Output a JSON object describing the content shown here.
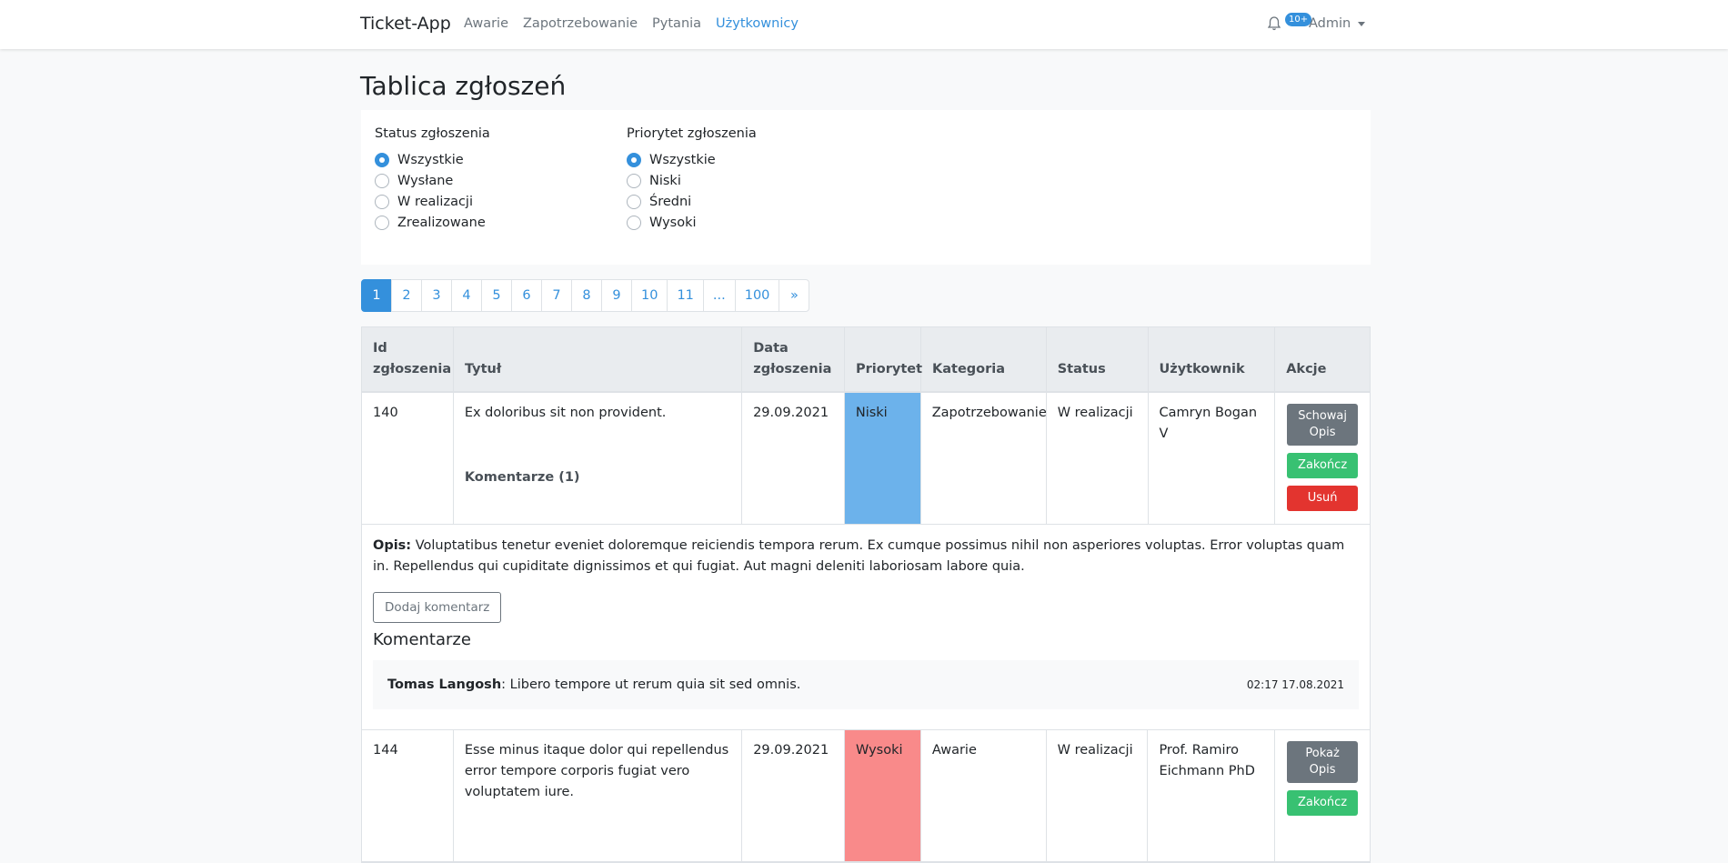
{
  "navbar": {
    "brand": "Ticket-App",
    "links": [
      "Awarie",
      "Zapotrzebowanie",
      "Pytania",
      "Użytkownicy"
    ],
    "active_link": "Użytkownicy",
    "notification_badge": "10+",
    "user": "Admin",
    "accent_color": "#3490dc"
  },
  "page_title": "Tablica zgłoszeń",
  "filters": {
    "status": {
      "label": "Status zgłoszenia",
      "options": [
        "Wszystkie",
        "Wysłane",
        "W realizacji",
        "Zrealizowane"
      ],
      "selected": "Wszystkie"
    },
    "priority": {
      "label": "Priorytet zgłoszenia",
      "options": [
        "Wszystkie",
        "Niski",
        "Średni",
        "Wysoki"
      ],
      "selected": "Wszystkie"
    }
  },
  "pagination": {
    "pages": [
      "1",
      "2",
      "3",
      "4",
      "5",
      "6",
      "7",
      "8",
      "9",
      "10",
      "11",
      "...",
      "100",
      "»"
    ],
    "current": "1"
  },
  "table": {
    "headers": [
      "Id zgłoszenia",
      "Tytuł",
      "Data zgłoszenia",
      "Priorytet",
      "Kategoria",
      "Status",
      "Użytkownik",
      "Akcje"
    ],
    "rows": [
      {
        "id": "140",
        "title": "Ex doloribus sit non provident.",
        "comments_link": "Komentarze (1)",
        "date": "29.09.2021",
        "priority": "Niski",
        "priority_color": "#6cb2eb",
        "category": "Zapotrzebowanie",
        "status": "W realizacji",
        "user": "Camryn Bogan V",
        "actions": {
          "toggle": "Schowaj Opis",
          "finish": "Zakończ",
          "delete": "Usuń"
        },
        "detail": {
          "desc_label": "Opis:",
          "description": "Voluptatibus tenetur eveniet doloremque reiciendis tempora rerum. Ex cumque possimus nihil non asperiores voluptas. Error voluptas quam in. Repellendus qui cupiditate dignissimos et qui fugiat. Aut magni deleniti laboriosam labore quia.",
          "add_comment": "Dodaj komentarz",
          "comments_heading": "Komentarze",
          "comments": [
            {
              "author": "Tomas Langosh",
              "text": ": Libero tempore ut rerum quia sit sed omnis.",
              "time": "02:17 17.08.2021"
            }
          ]
        }
      },
      {
        "id": "144",
        "title": "Esse minus itaque dolor qui repellendus error tempore corporis fugiat vero voluptatem iure.",
        "date": "29.09.2021",
        "priority": "Wysoki",
        "priority_color": "#f98a8a",
        "category": "Awarie",
        "status": "W realizacji",
        "user": "Prof. Ramiro Eichmann PhD",
        "actions": {
          "toggle": "Pokaż Opis",
          "finish": "Zakończ"
        }
      }
    ]
  }
}
